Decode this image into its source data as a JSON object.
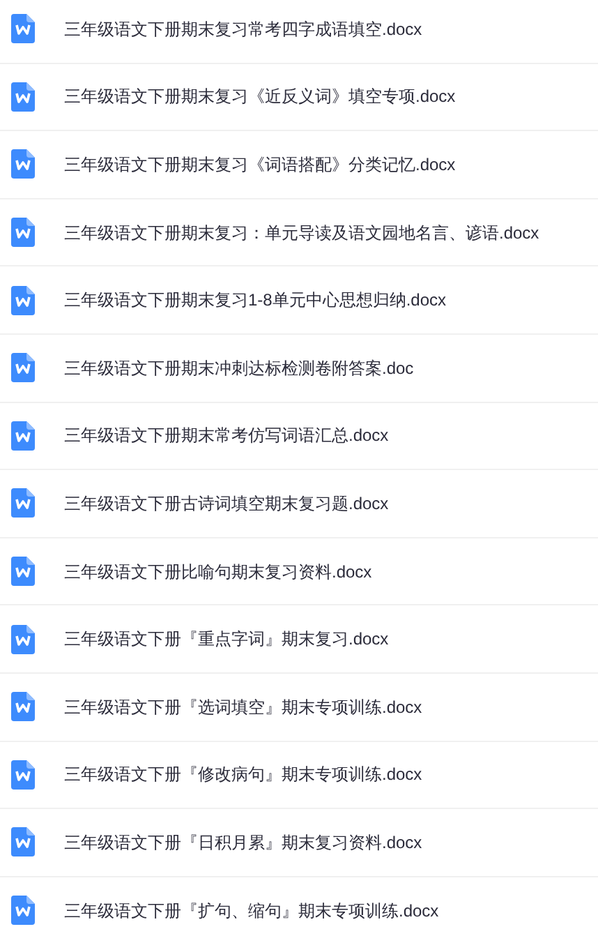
{
  "files": [
    {
      "name": "三年级语文下册期末复习常考四字成语填空.docx"
    },
    {
      "name": "三年级语文下册期末复习《近反义词》填空专项.docx"
    },
    {
      "name": "三年级语文下册期末复习《词语搭配》分类记忆.docx"
    },
    {
      "name": "三年级语文下册期末复习：单元导读及语文园地名言、谚语.docx"
    },
    {
      "name": "三年级语文下册期末复习1-8单元中心思想归纳.docx"
    },
    {
      "name": "三年级语文下册期末冲刺达标检测卷附答案.doc"
    },
    {
      "name": "三年级语文下册期末常考仿写词语汇总.docx"
    },
    {
      "name": "三年级语文下册古诗词填空期末复习题.docx"
    },
    {
      "name": "三年级语文下册比喻句期末复习资料.docx"
    },
    {
      "name": "三年级语文下册『重点字词』期末复习.docx"
    },
    {
      "name": "三年级语文下册『选词填空』期末专项训练.docx"
    },
    {
      "name": "三年级语文下册『修改病句』期末专项训练.docx"
    },
    {
      "name": "三年级语文下册『日积月累』期末复习资料.docx"
    },
    {
      "name": "三年级语文下册『扩句、缩句』期末专项训练.docx"
    }
  ]
}
